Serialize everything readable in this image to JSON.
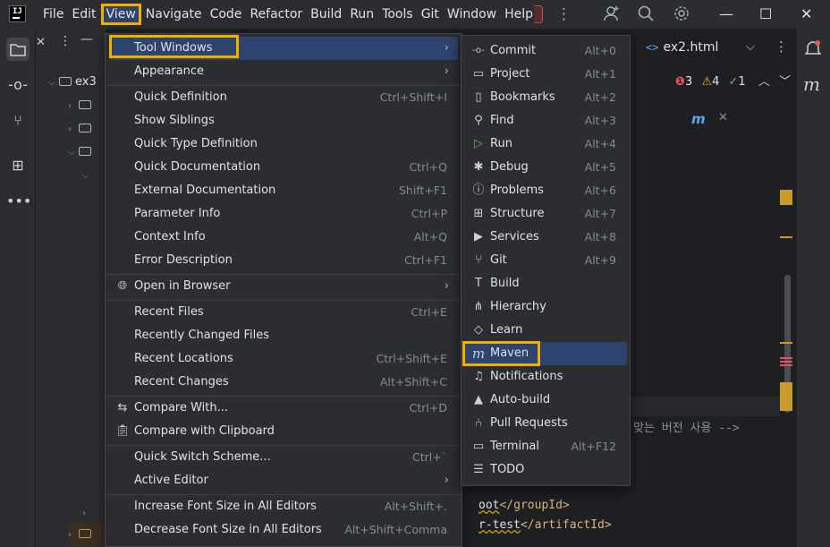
{
  "menubar": {
    "items": [
      {
        "label": "File"
      },
      {
        "label": "Edit"
      },
      {
        "label": "View"
      },
      {
        "label": "Navigate"
      },
      {
        "label": "Code"
      },
      {
        "label": "Refactor"
      },
      {
        "label": "Build"
      },
      {
        "label": "Run"
      },
      {
        "label": "Tools"
      },
      {
        "label": "Git"
      },
      {
        "label": "Window"
      },
      {
        "label": "Help"
      }
    ]
  },
  "project": {
    "root_label": "ex3"
  },
  "editor": {
    "tab_icon": "<>",
    "tab_title": "ex2.html",
    "status": {
      "errors": "3",
      "warnings": "4",
      "ok": "1"
    },
    "code_comment": "맞는 버전 사용 -->",
    "code_line_a_prefix": "oot",
    "code_line_a_tag": "</groupId>",
    "code_line_b_prefix": "r-test",
    "code_line_b_tag": "</artifactId>"
  },
  "view_menu": {
    "tool_windows": "Tool Windows",
    "appearance": "Appearance",
    "quick_definition": "Quick Definition",
    "quick_definition_sc": "Ctrl+Shift+I",
    "show_siblings": "Show Siblings",
    "quick_type_definition": "Quick Type Definition",
    "quick_documentation": "Quick Documentation",
    "quick_documentation_sc": "Ctrl+Q",
    "external_documentation": "External Documentation",
    "external_documentation_sc": "Shift+F1",
    "parameter_info": "Parameter Info",
    "parameter_info_sc": "Ctrl+P",
    "context_info": "Context Info",
    "context_info_sc": "Alt+Q",
    "error_description": "Error Description",
    "error_description_sc": "Ctrl+F1",
    "open_in_browser": "Open in Browser",
    "recent_files": "Recent Files",
    "recent_files_sc": "Ctrl+E",
    "recently_changed_files": "Recently Changed Files",
    "recent_locations": "Recent Locations",
    "recent_locations_sc": "Ctrl+Shift+E",
    "recent_changes": "Recent Changes",
    "recent_changes_sc": "Alt+Shift+C",
    "compare_with": "Compare With...",
    "compare_with_sc": "Ctrl+D",
    "compare_with_clipboard": "Compare with Clipboard",
    "quick_switch_scheme": "Quick Switch Scheme...",
    "quick_switch_scheme_sc": "Ctrl+`",
    "active_editor": "Active Editor",
    "increase_font": "Increase Font Size in All Editors",
    "increase_font_sc": "Alt+Shift+.",
    "decrease_font": "Decrease Font Size in All Editors",
    "decrease_font_sc": "Alt+Shift+Comma"
  },
  "tool_windows_menu": [
    {
      "label": "Commit",
      "shortcut": "Alt+0",
      "icon": "commit-icon",
      "glyph": "-o-"
    },
    {
      "label": "Project",
      "shortcut": "Alt+1",
      "icon": "folder-icon",
      "glyph": "▭"
    },
    {
      "label": "Bookmarks",
      "shortcut": "Alt+2",
      "icon": "bookmark-icon",
      "glyph": "▯"
    },
    {
      "label": "Find",
      "shortcut": "Alt+3",
      "icon": "search-icon",
      "glyph": "⚲"
    },
    {
      "label": "Run",
      "shortcut": "Alt+4",
      "icon": "run-icon",
      "glyph": "▷"
    },
    {
      "label": "Debug",
      "shortcut": "Alt+5",
      "icon": "debug-icon",
      "glyph": "✱"
    },
    {
      "label": "Problems",
      "shortcut": "Alt+6",
      "icon": "problems-icon",
      "glyph": "ⓘ"
    },
    {
      "label": "Structure",
      "shortcut": "Alt+7",
      "icon": "structure-icon",
      "glyph": "⊞"
    },
    {
      "label": "Services",
      "shortcut": "Alt+8",
      "icon": "services-icon",
      "glyph": "▶"
    },
    {
      "label": "Git",
      "shortcut": "Alt+9",
      "icon": "git-branch-icon",
      "glyph": "⑂"
    },
    {
      "label": "Build",
      "shortcut": "",
      "icon": "hammer-icon",
      "glyph": "T"
    },
    {
      "label": "Hierarchy",
      "shortcut": "",
      "icon": "hierarchy-icon",
      "glyph": "⋔"
    },
    {
      "label": "Learn",
      "shortcut": "",
      "icon": "learn-icon",
      "glyph": "◇"
    },
    {
      "label": "Maven",
      "shortcut": "",
      "icon": "maven-icon",
      "glyph": "m"
    },
    {
      "label": "Notifications",
      "shortcut": "",
      "icon": "bell-icon",
      "glyph": "♫"
    },
    {
      "label": "Auto-build",
      "shortcut": "",
      "icon": "warning-icon",
      "glyph": "▲"
    },
    {
      "label": "Pull Requests",
      "shortcut": "",
      "icon": "pull-request-icon",
      "glyph": "⑃"
    },
    {
      "label": "Terminal",
      "shortcut": "Alt+F12",
      "icon": "terminal-icon",
      "glyph": "▭"
    },
    {
      "label": "TODO",
      "shortcut": "",
      "icon": "todo-icon",
      "glyph": "☰"
    }
  ],
  "colors": {
    "highlight": "#2e436e",
    "annotation_outline": "#f0b000",
    "error": "#e55757",
    "warning": "#f0b000",
    "ok": "#5fb865"
  }
}
